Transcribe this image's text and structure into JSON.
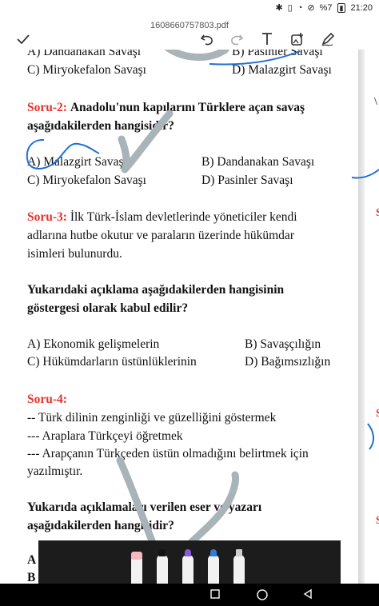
{
  "status_bar": {
    "icons": [
      "bluetooth-icon",
      "vibrate-icon",
      "wifi-icon",
      "no-sim-icon",
      "battery-icon"
    ],
    "battery_level": "%7",
    "time": "21:20"
  },
  "app": {
    "file_name": "1608660757803.pdf",
    "toolbar": {
      "done": "check-icon",
      "undo": "undo-icon",
      "redo": "redo-icon",
      "text": "text-tool-icon",
      "image": "image-tool-icon",
      "pen": "pen-tool-icon"
    }
  },
  "document": {
    "prev_options": {
      "a": "A) Dandanakan Savaşı",
      "b": "B) Pasinler Savaşı",
      "c": "C) Miryokefalon Savaşı",
      "d": "D) Malazgirt Savaşı"
    },
    "q2": {
      "label": "Soru-2:",
      "text_line1": "Anadolu'nun kapılarını Türklere açan savaş",
      "text_line2": "aşağıdakilerden hangisidir?",
      "a": "A) Malazgirt Savaşı",
      "b": "B) Dandanakan Savaşı",
      "c": "C) Miryokefalon Savaşı",
      "d": "D) Pasinler Savaşı"
    },
    "q3": {
      "label": "Soru-3:",
      "text_line1": "İlk Türk-İslam devletlerinde yöneticiler kendi",
      "text_line2": "adlarına hutbe okutur ve paraların üzerinde hükümdar",
      "text_line3": "isimleri bulunurdu.",
      "question_line1": "Yukarıdaki açıklama aşağıdakilerden hangisinin",
      "question_line2": "göstergesi olarak kabul edilir?",
      "a": "A) Ekonomik gelişmelerin",
      "b": "B) Savaşçılığın",
      "c": "C) Hükümdarların üstünlüklerinin",
      "d": "D) Bağımsızlığın"
    },
    "q4": {
      "label": "Soru-4:",
      "line1": "-- Türk dilinin zenginliği ve güzelliğini göstermek",
      "line2": "--- Araplara Türkçeyi öğretmek",
      "line3": "--- Arapçanın Türkçeden üstün olmadığını belirtmek için",
      "line4": "yazılmıştır.",
      "question_line1": "Yukarıda açıklamaları verilen eser ve yazarı",
      "question_line2": "aşağıdakilerden hangisidir?",
      "partial_a": "A",
      "partial_b": "B"
    }
  },
  "pen_tray": {
    "tools": [
      "eraser",
      "black-pen",
      "purple-pen",
      "blue-pen",
      "highlighter"
    ],
    "colors": {
      "eraser": "#f7b7c2",
      "black-pen": "#111111",
      "purple-pen": "#8a5bd6",
      "blue-pen": "#2f7fd8",
      "highlighter": "#cfcfcf"
    }
  },
  "annotation_colors": {
    "gray": "#a9b4b9",
    "blue": "#1f6fd2"
  },
  "nav_bar": {
    "icons": [
      "recents-icon",
      "home-icon",
      "back-icon"
    ]
  }
}
